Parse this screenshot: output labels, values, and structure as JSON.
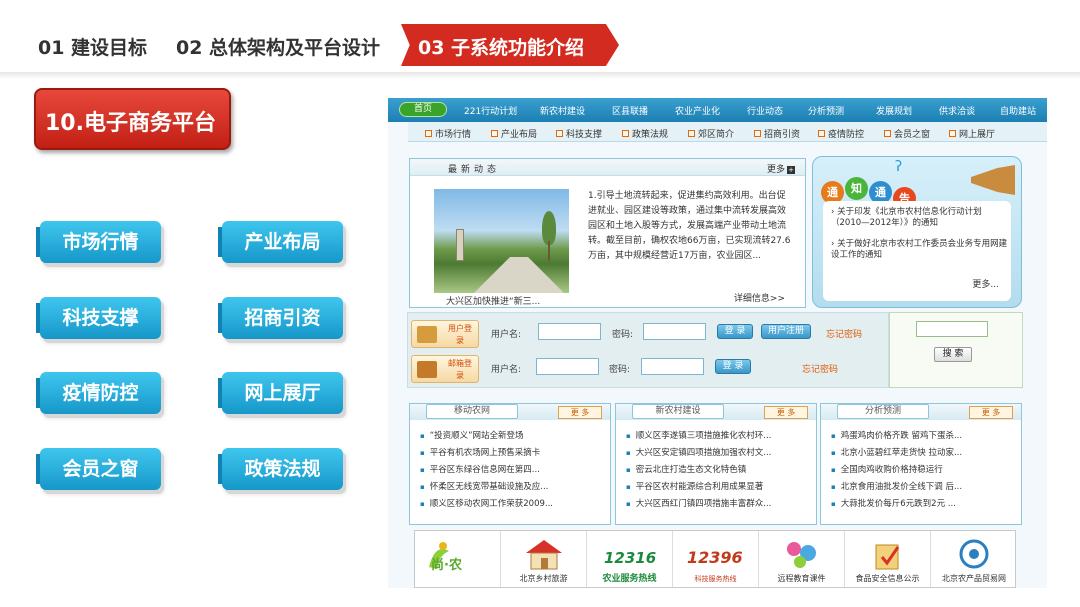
{
  "nav": {
    "item1": "01  建设目标",
    "item2": "02 总体架构及平台设计",
    "active": "03   子系统功能介绍"
  },
  "section_badge": "10.电子商务平台",
  "features": [
    "市场行情",
    "产业布局",
    "科技支撑",
    "招商引资",
    "疫情防控",
    "网上展厅",
    "会员之窗",
    "政策法规"
  ],
  "site": {
    "home": "首页",
    "nav1": [
      "221行动计划",
      "新农村建设",
      "区县联播",
      "农业产业化",
      "行业动态",
      "分析预测",
      "发展规划",
      "供求洽谈",
      "自助建站"
    ],
    "nav2": [
      "市场行情",
      "产业布局",
      "科技支撑",
      "政策法规",
      "郊区简介",
      "招商引资",
      "疫情防控",
      "会员之窗",
      "网上展厅"
    ],
    "news": {
      "title": "最新动态",
      "more": "更多",
      "photo_caption": "大兴区加快推进“新三...",
      "body": "1.引导土地流转起来，促进集约高效利用。出台促进就业、园区建设等政策，通过集中流转发展高效园区和土地入股等方式，发展高端产业带动土地流转。截至目前，确权农地66万亩，已实现流转27.6万亩，其中规模经营近17万亩，农业园区...",
      "detail": "详细信息>>"
    },
    "notice": {
      "bubbles": [
        "通",
        "知",
        "通",
        "告"
      ],
      "line1": "› 关于印发《北京市农村信息化行动计划（2010—2012年）》的通知",
      "line2": "› 关于做好北京市农村工作委员会业务专用网建设工作的通知",
      "more": "更多..."
    },
    "login": {
      "user_tag": "用户登录",
      "mail_tag": "邮箱登录",
      "username_label": "用户名:",
      "password_label": "密码:",
      "login_btn": "登 录",
      "register_btn": "用户注册",
      "forgot": "忘记密码",
      "mail_username_label": "用户名:",
      "mail_password_label": "密码:",
      "mail_login_btn": "登 录",
      "mail_forgot": "忘记密码"
    },
    "search_btn": "搜 索",
    "panels": [
      {
        "title": "移动农网",
        "more": "更 多",
        "items": [
          "“投资顺义”网站全新登场",
          "平谷有机农场网上预售采摘卡",
          "平谷区东绿谷信息网在第四...",
          "怀柔区无线宽带基础设施及应...",
          "顺义区移动农网工作荣获2009..."
        ]
      },
      {
        "title": "新农村建设",
        "more": "更 多",
        "items": [
          "顺义区李遂镇三项措施推化农村环...",
          "大兴区安定镇四项措施加强农村文...",
          "密云北庄打造生态文化特色镇",
          "平谷区农村能源综合利用成果显著",
          "大兴区西红门镇四项措施丰富群众..."
        ]
      },
      {
        "title": "分析预测",
        "more": "更 多",
        "items": [
          "鸡蛋鸡肉价格齐跌 留鸡下蛋杀...",
          "北京小蓝碧红苹走货快 拉动家...",
          "全国肉鸡收购价格持稳运行",
          "北京食用油批发价全线下调 后...",
          "大蒜批发价每斤6元跌到2元 ..."
        ]
      }
    ],
    "logos": [
      "尚·农",
      "北京乡村旅游",
      "农业服务热线",
      "科技服务热线",
      "远程教育课件",
      "食品安全信息公示",
      "北京农产品贸易网"
    ],
    "logo_marks": [
      "",
      "",
      "12316",
      "12396",
      "",
      "",
      ""
    ]
  }
}
